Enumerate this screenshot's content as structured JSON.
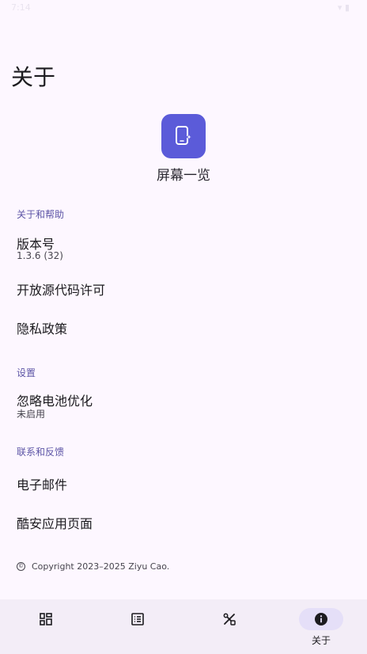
{
  "status_bar": {
    "time": "7:14",
    "icons": "▾ ▮"
  },
  "page": {
    "title": "关于"
  },
  "app": {
    "name": "屏幕一览",
    "accent": "#5b5bd9"
  },
  "sections": {
    "about": {
      "header": "关于和帮助",
      "version_title": "版本号",
      "version_value": "1.3.6 (32)",
      "open_source": "开放源代码许可",
      "privacy": "隐私政策"
    },
    "settings": {
      "header": "设置",
      "battery_title": "忽略电池优化",
      "battery_value": "未启用"
    },
    "contact": {
      "header": "联系和反馈",
      "email": "电子邮件",
      "coolapk": "酷安应用页面"
    }
  },
  "footer": {
    "copyright_symbol": "©",
    "copyright": "Copyright 2023–2025 Ziyu Cao."
  },
  "nav": {
    "items": [
      {
        "icon": "grid-icon"
      },
      {
        "icon": "list-icon"
      },
      {
        "icon": "tools-icon"
      },
      {
        "icon": "info-icon",
        "label": "关于",
        "active": true
      }
    ]
  }
}
